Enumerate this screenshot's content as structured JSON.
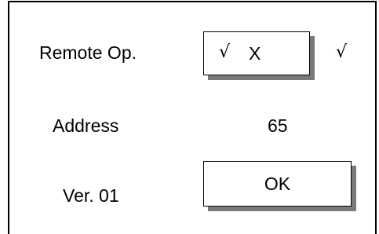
{
  "remote_op": {
    "label": "Remote Op.",
    "box_check": "√",
    "box_option": "X",
    "current_check": "√"
  },
  "address": {
    "label": "Address",
    "value": "65"
  },
  "version": {
    "label": "Ver. 01"
  },
  "ok_button": {
    "label": "OK"
  },
  "colors": {
    "border": "#000000",
    "shadow": "#7a7a7a",
    "background": "#ffffff"
  }
}
